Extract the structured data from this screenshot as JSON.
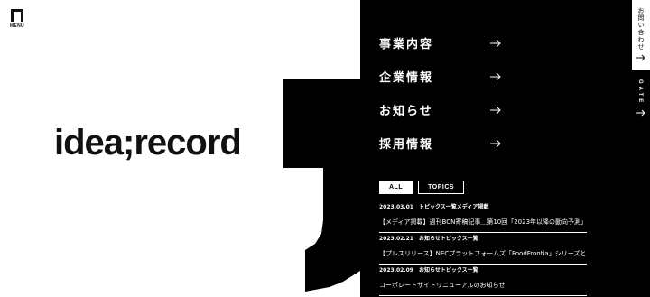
{
  "header": {
    "menu_label": "MENU"
  },
  "hero": {
    "logo_text": "idea;record"
  },
  "nav": {
    "items": [
      {
        "label": "事業内容"
      },
      {
        "label": "企業情報"
      },
      {
        "label": "お知らせ"
      },
      {
        "label": "採用情報"
      }
    ]
  },
  "news": {
    "tabs": [
      {
        "label": "ALL",
        "active": true
      },
      {
        "label": "TOPICS",
        "active": false
      }
    ],
    "items": [
      {
        "date": "2023.03.01",
        "category": "トピックス一覧メディア掲載",
        "title": "【メディア掲載】週刊BCN寄稿記事＿第10回「2023年以降の動向予測」..."
      },
      {
        "date": "2023.02.21",
        "category": "お知らせトピックス一覧",
        "title": "【プレスリリース】NECプラットフォームズ「FoodFrontia」シリーズと..."
      },
      {
        "date": "2023.02.09",
        "category": "お知らせトピックス一覧",
        "title": "コーポレートサイトリニューアルのお知らせ"
      }
    ]
  },
  "side": {
    "contact_label": "お問い合わせ",
    "gate_label": "GATE"
  },
  "colors": {
    "background": "#ffffff",
    "panel": "#000000",
    "text": "#111111"
  }
}
